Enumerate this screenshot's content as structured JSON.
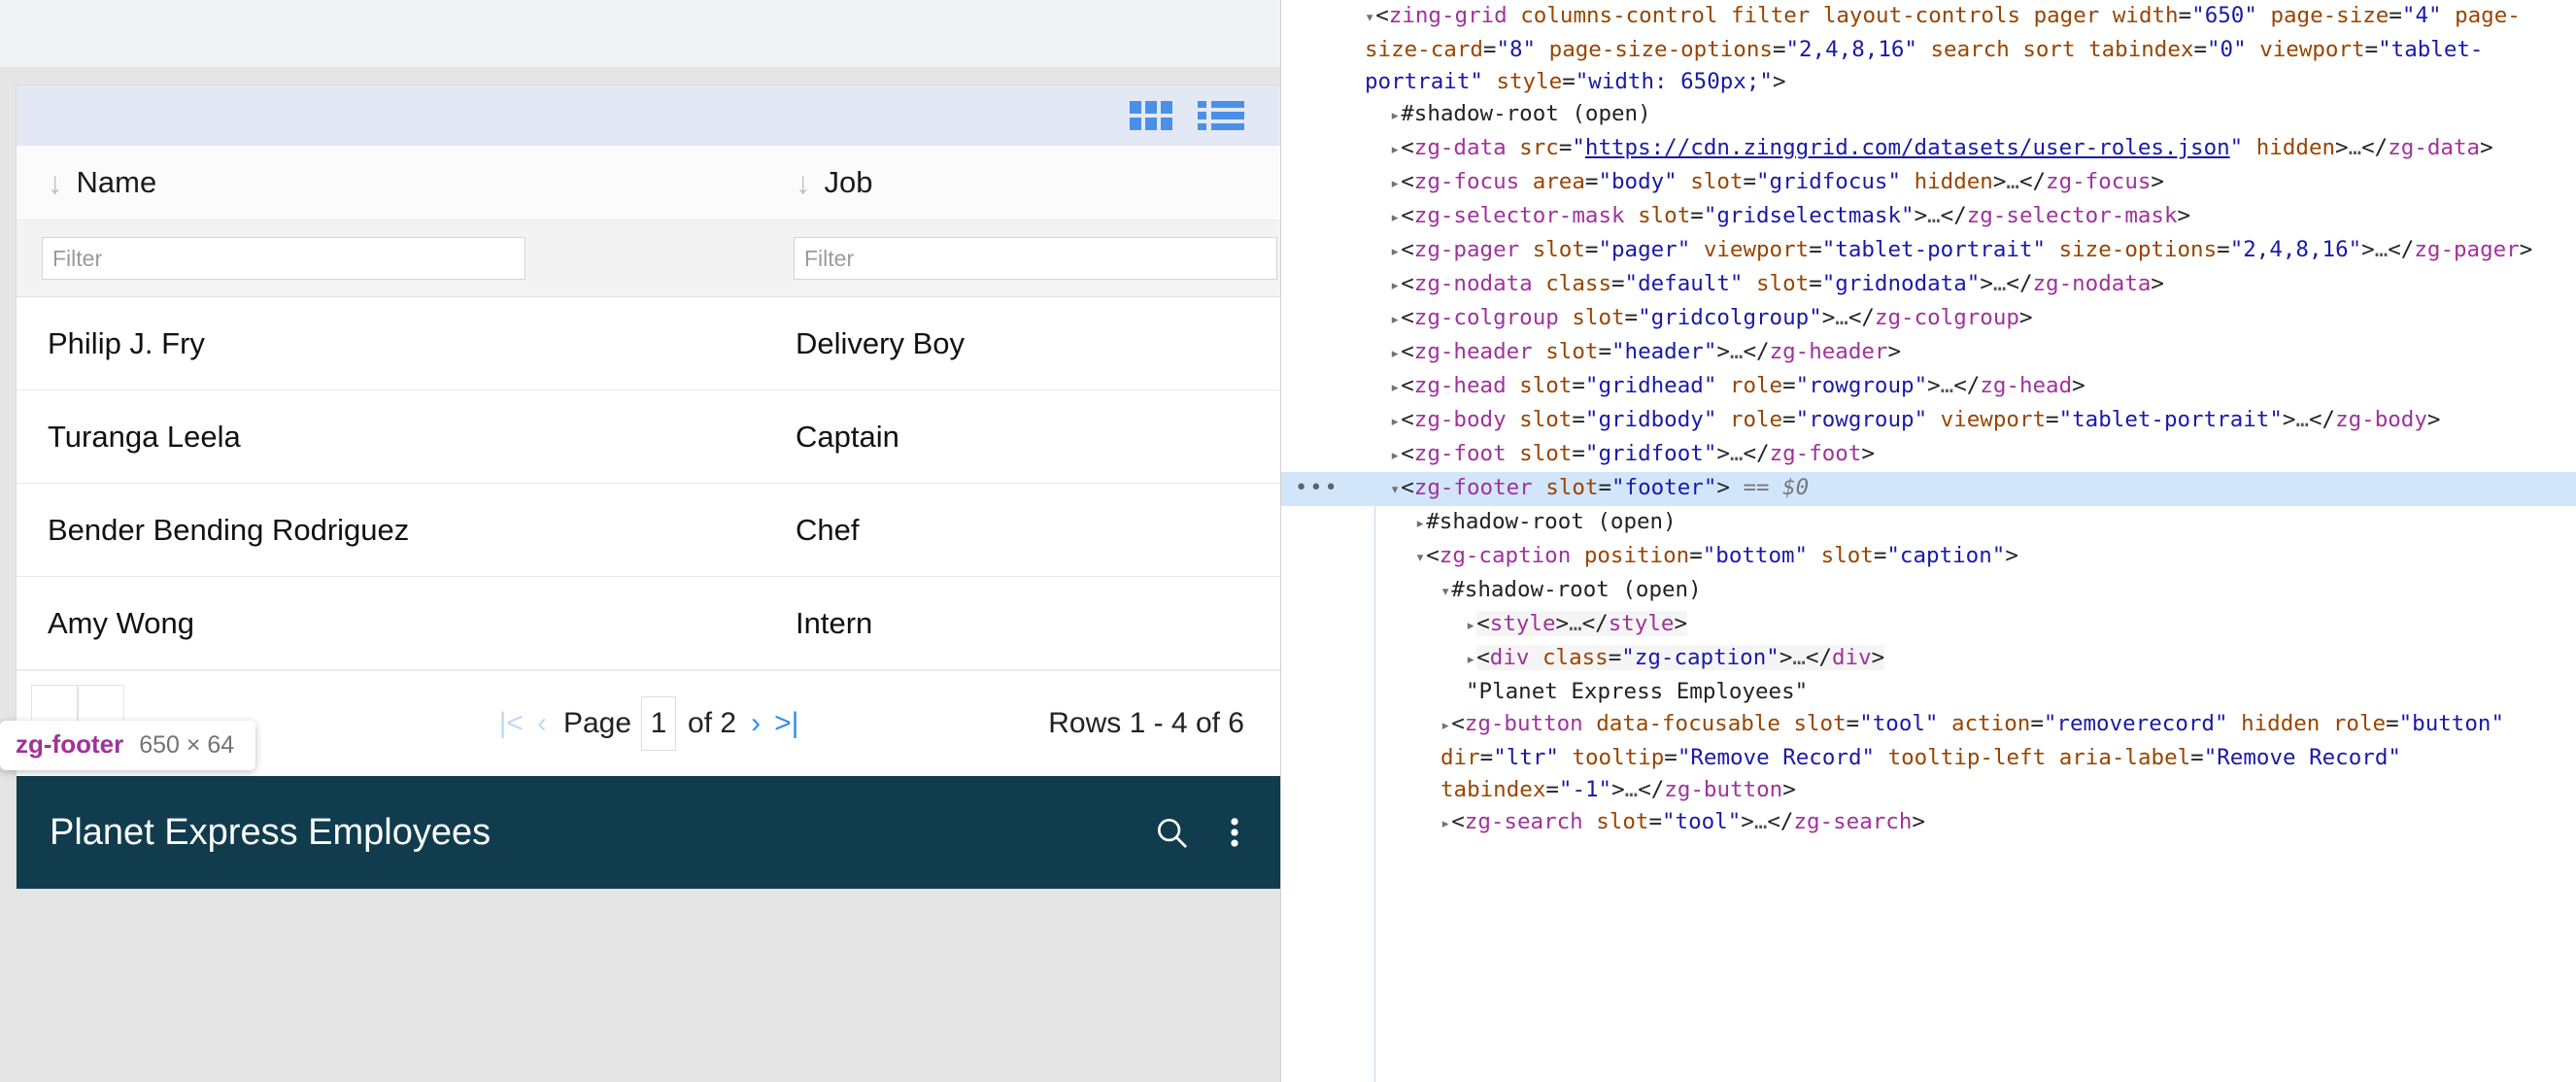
{
  "page": {
    "grid": {
      "layout_controls": {
        "card_view_icon": "grid-card-view-icon",
        "row_view_icon": "grid-row-view-icon"
      },
      "columns": [
        {
          "label": "Name",
          "sort_icon": "sort-descending-arrow-icon",
          "filter_placeholder": "Filter"
        },
        {
          "label": "Job",
          "sort_icon": "sort-descending-arrow-icon",
          "filter_placeholder": "Filter"
        }
      ],
      "rows": [
        {
          "name": "Philip J. Fry",
          "job": "Delivery Boy"
        },
        {
          "name": "Turanga Leela",
          "job": "Captain"
        },
        {
          "name": "Bender Bending Rodriguez",
          "job": "Chef"
        },
        {
          "name": "Amy Wong",
          "job": "Intern"
        }
      ],
      "pager": {
        "first_icon": "|<",
        "prev_icon": "‹",
        "page_label": "Page",
        "page_value": "1",
        "of_label": "of 2",
        "next_icon": "›",
        "last_icon": ">|",
        "rows_status": "Rows 1 - 4 of 6"
      },
      "footer": {
        "caption": "Planet Express Employees",
        "search_icon": "search-icon",
        "menu_icon": "kebab-menu-icon"
      }
    },
    "inspect_badge": {
      "tag": "zg-footer",
      "dimensions": "650 × 64"
    }
  },
  "devtools": {
    "selected_marker": "== $0",
    "lines": [
      {
        "id": "zing-grid",
        "indent": 0,
        "triangle": "▾",
        "html": "<span class=\"punct\">&lt;</span><span class=\"tag\">zing-grid</span> <span class=\"attr\">columns-control</span> <span class=\"attr\">filter</span> <span class=\"attr\">layout-controls</span> <span class=\"attr\">pager</span> <span class=\"attr\">width</span>=<span class=\"val\">\"650\"</span> <span class=\"attr\">page-size</span>=<span class=\"val\">\"4\"</span> <span class=\"attr\">page-size-card</span>=<span class=\"val\">\"8\"</span> <span class=\"attr\">page-size-options</span>=<span class=\"val\">\"2,4,8,16\"</span> <span class=\"attr\">search</span> <span class=\"attr\">sort</span> <span class=\"attr\">tabindex</span>=<span class=\"val\">\"0\"</span> <span class=\"attr\">viewport</span>=<span class=\"val\">\"tablet-portrait\"</span> <span class=\"attr\">style</span>=<span class=\"val\">\"width: 650px;\"</span><span class=\"punct\">&gt;</span>"
      },
      {
        "id": "shadow-root-1",
        "indent": 1,
        "triangle": "▸",
        "html": "<span class=\"shadow\">#shadow-root (open)</span>"
      },
      {
        "id": "zg-data",
        "indent": 1,
        "triangle": "▸",
        "html": "<span class=\"punct\">&lt;</span><span class=\"tag\">zg-data</span> <span class=\"attr\">src</span>=<span class=\"val\">\"</span><span class=\"link\">https://cdn.zinggrid.com/datasets/user-roles.json</span><span class=\"val\">\"</span> <span class=\"attr\">hidden</span><span class=\"punct\">&gt;</span><span class=\"dots\">…</span><span class=\"punct\">&lt;/</span><span class=\"tag\">zg-data</span><span class=\"punct\">&gt;</span>"
      },
      {
        "id": "zg-focus",
        "indent": 1,
        "triangle": "▸",
        "html": "<span class=\"punct\">&lt;</span><span class=\"tag\">zg-focus</span> <span class=\"attr\">area</span>=<span class=\"val\">\"body\"</span> <span class=\"attr\">slot</span>=<span class=\"val\">\"gridfocus\"</span> <span class=\"attr\">hidden</span><span class=\"punct\">&gt;</span><span class=\"dots\">…</span><span class=\"punct\">&lt;/</span><span class=\"tag\">zg-focus</span><span class=\"punct\">&gt;</span>"
      },
      {
        "id": "zg-selector-mask",
        "indent": 1,
        "triangle": "▸",
        "html": "<span class=\"punct\">&lt;</span><span class=\"tag\">zg-selector-mask</span> <span class=\"attr\">slot</span>=<span class=\"val\">\"gridselectmask\"</span><span class=\"punct\">&gt;</span><span class=\"dots\">…</span><span class=\"punct\">&lt;/</span><span class=\"tag\">zg-selector-mask</span><span class=\"punct\">&gt;</span>"
      },
      {
        "id": "zg-pager",
        "indent": 1,
        "triangle": "▸",
        "html": "<span class=\"punct\">&lt;</span><span class=\"tag\">zg-pager</span> <span class=\"attr\">slot</span>=<span class=\"val\">\"pager\"</span> <span class=\"attr\">viewport</span>=<span class=\"val\">\"tablet-portrait\"</span> <span class=\"attr\">size-options</span>=<span class=\"val\">\"2,4,8,16\"</span><span class=\"punct\">&gt;</span><span class=\"dots\">…</span><span class=\"punct\">&lt;/</span><span class=\"tag\">zg-pager</span><span class=\"punct\">&gt;</span>"
      },
      {
        "id": "zg-nodata",
        "indent": 1,
        "triangle": "▸",
        "html": "<span class=\"punct\">&lt;</span><span class=\"tag\">zg-nodata</span> <span class=\"attr\">class</span>=<span class=\"val\">\"default\"</span> <span class=\"attr\">slot</span>=<span class=\"val\">\"gridnodata\"</span><span class=\"punct\">&gt;</span><span class=\"dots\">…</span><span class=\"punct\">&lt;/</span><span class=\"tag\">zg-nodata</span><span class=\"punct\">&gt;</span>"
      },
      {
        "id": "zg-colgroup",
        "indent": 1,
        "triangle": "▸",
        "html": "<span class=\"punct\">&lt;</span><span class=\"tag\">zg-colgroup</span> <span class=\"attr\">slot</span>=<span class=\"val\">\"gridcolgroup\"</span><span class=\"punct\">&gt;</span><span class=\"dots\">…</span><span class=\"punct\">&lt;/</span><span class=\"tag\">zg-colgroup</span><span class=\"punct\">&gt;</span>"
      },
      {
        "id": "zg-header",
        "indent": 1,
        "triangle": "▸",
        "html": "<span class=\"punct\">&lt;</span><span class=\"tag\">zg-header</span> <span class=\"attr\">slot</span>=<span class=\"val\">\"header\"</span><span class=\"punct\">&gt;</span><span class=\"dots\">…</span><span class=\"punct\">&lt;/</span><span class=\"tag\">zg-header</span><span class=\"punct\">&gt;</span>"
      },
      {
        "id": "zg-head",
        "indent": 1,
        "triangle": "▸",
        "html": "<span class=\"punct\">&lt;</span><span class=\"tag\">zg-head</span> <span class=\"attr\">slot</span>=<span class=\"val\">\"gridhead\"</span> <span class=\"attr\">role</span>=<span class=\"val\">\"rowgroup\"</span><span class=\"punct\">&gt;</span><span class=\"dots\">…</span><span class=\"punct\">&lt;/</span><span class=\"tag\">zg-head</span><span class=\"punct\">&gt;</span>"
      },
      {
        "id": "zg-body",
        "indent": 1,
        "triangle": "▸",
        "html": "<span class=\"punct\">&lt;</span><span class=\"tag\">zg-body</span> <span class=\"attr\">slot</span>=<span class=\"val\">\"gridbody\"</span> <span class=\"attr\">role</span>=<span class=\"val\">\"rowgroup\"</span> <span class=\"attr\">viewport</span>=<span class=\"val\">\"tablet-portrait\"</span><span class=\"punct\">&gt;</span><span class=\"dots\">…</span><span class=\"punct\">&lt;/</span><span class=\"tag\">zg-body</span><span class=\"punct\">&gt;</span>"
      },
      {
        "id": "zg-foot",
        "indent": 1,
        "triangle": "▸",
        "html": "<span class=\"punct\">&lt;</span><span class=\"tag\">zg-foot</span> <span class=\"attr\">slot</span>=<span class=\"val\">\"gridfoot\"</span><span class=\"punct\">&gt;</span><span class=\"dots\">…</span><span class=\"punct\">&lt;/</span><span class=\"tag\">zg-foot</span><span class=\"punct\">&gt;</span>"
      },
      {
        "id": "zg-footer",
        "indent": 1,
        "triangle": "▾",
        "selected": true,
        "badge_dots": "•••",
        "html": "<span class=\"punct\">&lt;</span><span class=\"tag\">zg-footer</span> <span class=\"attr\">slot</span>=<span class=\"val\">\"footer\"</span><span class=\"punct\">&gt;</span> <span class=\"eq0\">== $0</span>"
      },
      {
        "id": "shadow-root-2",
        "indent": 2,
        "triangle": "▸",
        "html": "<span class=\"shadow\">#shadow-root (open)</span>"
      },
      {
        "id": "zg-caption",
        "indent": 2,
        "triangle": "▾",
        "html": "<span class=\"punct\">&lt;</span><span class=\"tag\">zg-caption</span> <span class=\"attr\">position</span>=<span class=\"val\">\"bottom\"</span> <span class=\"attr\">slot</span>=<span class=\"val\">\"caption\"</span><span class=\"punct\">&gt;</span>"
      },
      {
        "id": "shadow-root-3",
        "indent": 3,
        "triangle": "▾",
        "html": "<span class=\"shadow\">#shadow-root (open)</span>"
      },
      {
        "id": "style",
        "indent": 4,
        "triangle": "▸",
        "shaded": true,
        "html": "<span class=\"punct\">&lt;</span><span class=\"tag\">style</span><span class=\"punct\">&gt;</span><span class=\"dots\">…</span><span class=\"punct\">&lt;/</span><span class=\"tag\">style</span><span class=\"punct\">&gt;</span>"
      },
      {
        "id": "div-zg-caption",
        "indent": 4,
        "triangle": "▸",
        "shaded": true,
        "html": "<span class=\"punct\">&lt;</span><span class=\"tag\">div</span> <span class=\"attr\">class</span>=<span class=\"val\">\"zg-caption\"</span><span class=\"punct\">&gt;</span><span class=\"dots\">…</span><span class=\"punct\">&lt;/</span><span class=\"tag\">div</span><span class=\"punct\">&gt;</span>"
      },
      {
        "id": "caption-text",
        "indent": 4,
        "triangle": "",
        "html": "<span class=\"txtnode\">\"Planet Express Employees\"</span>"
      },
      {
        "id": "zg-button",
        "indent": 3,
        "triangle": "▸",
        "html": "<span class=\"punct\">&lt;</span><span class=\"tag\">zg-button</span> <span class=\"attr\">data-focusable</span> <span class=\"attr\">slot</span>=<span class=\"val\">\"tool\"</span> <span class=\"attr\">action</span>=<span class=\"val\">\"removerecord\"</span> <span class=\"attr\">hidden</span> <span class=\"attr\">role</span>=<span class=\"val\">\"button\"</span> <span class=\"attr\">dir</span>=<span class=\"val\">\"ltr\"</span> <span class=\"attr\">tooltip</span>=<span class=\"val\">\"Remove Record\"</span> <span class=\"attr\">tooltip-left</span> <span class=\"attr\">aria-label</span>=<span class=\"val\">\"Remove Record\"</span> <span class=\"attr\">tabindex</span>=<span class=\"val\">\"-1\"</span><span class=\"punct\">&gt;</span><span class=\"dots\">…</span><span class=\"punct\">&lt;/</span><span class=\"tag\">zg-button</span><span class=\"punct\">&gt;</span>"
      },
      {
        "id": "zg-search",
        "indent": 3,
        "triangle": "▸",
        "html": "<span class=\"punct\">&lt;</span><span class=\"tag\">zg-search</span> <span class=\"attr\">slot</span>=<span class=\"val\">\"tool\"</span><span class=\"punct\">&gt;</span><span class=\"dots\">…</span><span class=\"punct\">&lt;/</span><span class=\"tag\">zg-search</span><span class=\"punct\">&gt;</span>"
      }
    ]
  }
}
